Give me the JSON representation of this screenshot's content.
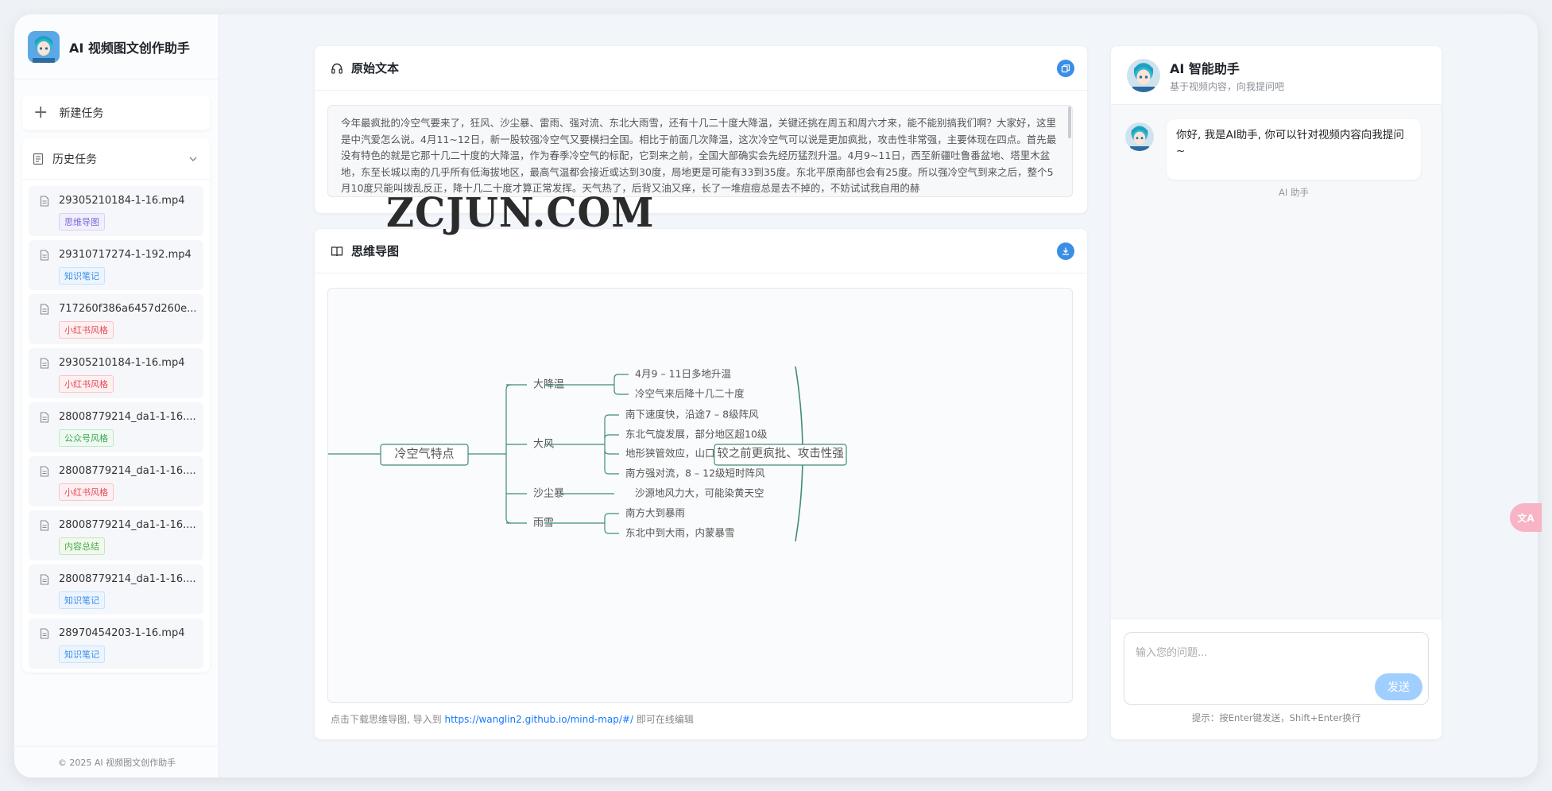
{
  "app": {
    "title": "AI 视频图文创作助手",
    "footer": "© 2025 AI 视频图文创作助手"
  },
  "sidebar": {
    "new_task": "新建任务",
    "history_title": "历史任务",
    "items": [
      {
        "name": "29305210184-1-16.mp4",
        "tag": "思维导图",
        "tag_kind": "t-mind"
      },
      {
        "name": "29310717274-1-192.mp4",
        "tag": "知识笔记",
        "tag_kind": "t-note"
      },
      {
        "name": "717260f386a6457d260e...",
        "tag": "小红书风格",
        "tag_kind": "t-xhs"
      },
      {
        "name": "29305210184-1-16.mp4",
        "tag": "小红书风格",
        "tag_kind": "t-xhs"
      },
      {
        "name": "28008779214_da1-1-16....",
        "tag": "公众号风格",
        "tag_kind": "t-gzh"
      },
      {
        "name": "28008779214_da1-1-16....",
        "tag": "小红书风格",
        "tag_kind": "t-xhs"
      },
      {
        "name": "28008779214_da1-1-16....",
        "tag": "内容总结",
        "tag_kind": "t-sum"
      },
      {
        "name": "28008779214_da1-1-16....",
        "tag": "知识笔记",
        "tag_kind": "t-note"
      },
      {
        "name": "28970454203-1-16.mp4",
        "tag": "知识笔记",
        "tag_kind": "t-note"
      }
    ]
  },
  "original": {
    "title": "原始文本",
    "text": "今年最疯批的冷空气要来了，狂风、沙尘暴、雷雨、强对流、东北大雨雪，还有十几二十度大降温，关键还挑在周五和周六才来，能不能别搞我们啊？大家好，这里是中汽爱怎么说。4月11~12日，新一股较强冷空气又要横扫全国。相比于前面几次降温，这次冷空气可以说是更加疯批，攻击性非常强，主要体现在四点。首先最没有特色的就是它那十几二十度的大降温，作为春季冷空气的标配，它到来之前，全国大部确实会先经历猛烈升温。4月9~11日，西至新疆吐鲁番盆地、塔里木盆地，东至长城以南的几乎所有低海拔地区，最高气温都会接近或达到30度，局地更是可能有33到35度。东北平原南部也会有25度。所以强冷空气到来之后，整个5月10度只能叫拨乱反正，降十几二十度才算正常发挥。天气热了，后背又油又痒，长了一堆痘痘总是去不掉的，不妨试试我自用的赫"
  },
  "mindmap": {
    "title": "思维导图",
    "root": "冷空气特点",
    "branches": [
      {
        "label": "大降温",
        "leaves": [
          "4月9 – 11日多地升温",
          "冷空气来后降十几二十度"
        ]
      },
      {
        "label": "大风",
        "leaves": [
          "南下速度快，沿途7 – 8级阵风",
          "东北气旋发展，部分地区超10级",
          "地形狭管效应，山口12 – 14级",
          "南方强对流，8 – 12级短时阵风"
        ]
      },
      {
        "label": "沙尘暴",
        "leaves": [
          "沙源地风力大，可能染黄天空"
        ]
      },
      {
        "label": "雨雪",
        "leaves": [
          "南方大到暴雨",
          "东北中到大雨，内蒙暴雪"
        ]
      }
    ],
    "summary": "较之前更疯批、攻击性强",
    "hint_prefix": "点击下载思维导图, 导入到",
    "hint_link": "https://wanglin2.github.io/mind-map/#/",
    "hint_suffix": "即可在线编辑"
  },
  "watermark": "ZCJUN.COM",
  "chat": {
    "title": "AI 智能助手",
    "subtitle": "基于视频内容，向我提问吧",
    "message": "你好, 我是AI助手, 你可以针对视频内容向我提问 ~",
    "sender": "AI 助手",
    "placeholder": "输入您的问题...",
    "send": "发送",
    "hint": "提示：按Enter键发送，Shift+Enter换行"
  },
  "colors": {
    "accent": "#3a8ee6",
    "mind_line": "#3f8d75",
    "send_disabled": "#a0cfff"
  }
}
